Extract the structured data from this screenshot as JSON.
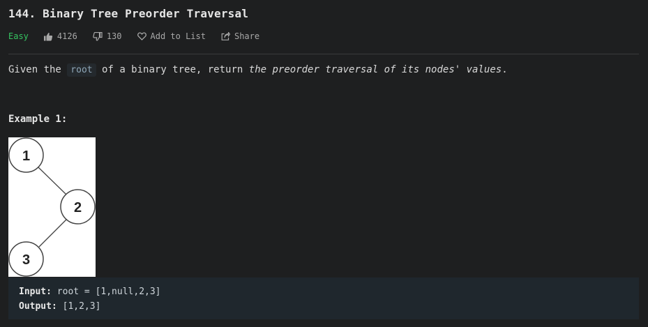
{
  "problem": {
    "title": "144. Binary Tree Preorder Traversal",
    "difficulty": "Easy",
    "likes": "4126",
    "dislikes": "130",
    "add_to_list": "Add to List",
    "share": "Share"
  },
  "description": {
    "part1": "Given the ",
    "code": "root",
    "part2": " of a binary tree, return ",
    "emphasis": "the preorder traversal of its nodes' values",
    "part3": "."
  },
  "example": {
    "title": "Example 1:",
    "nodes": [
      "1",
      "2",
      "3"
    ],
    "input_label": "Input:",
    "input_value": " root = [1,null,2,3]",
    "output_label": "Output:",
    "output_value": " [1,2,3]"
  },
  "colors": {
    "background": "#1e1f20",
    "easy": "#35c461",
    "code_bg": "#24292d",
    "example_box_bg": "#1f272d"
  },
  "icons": [
    "thumbs-up-icon",
    "thumbs-down-icon",
    "heart-icon",
    "share-icon"
  ]
}
